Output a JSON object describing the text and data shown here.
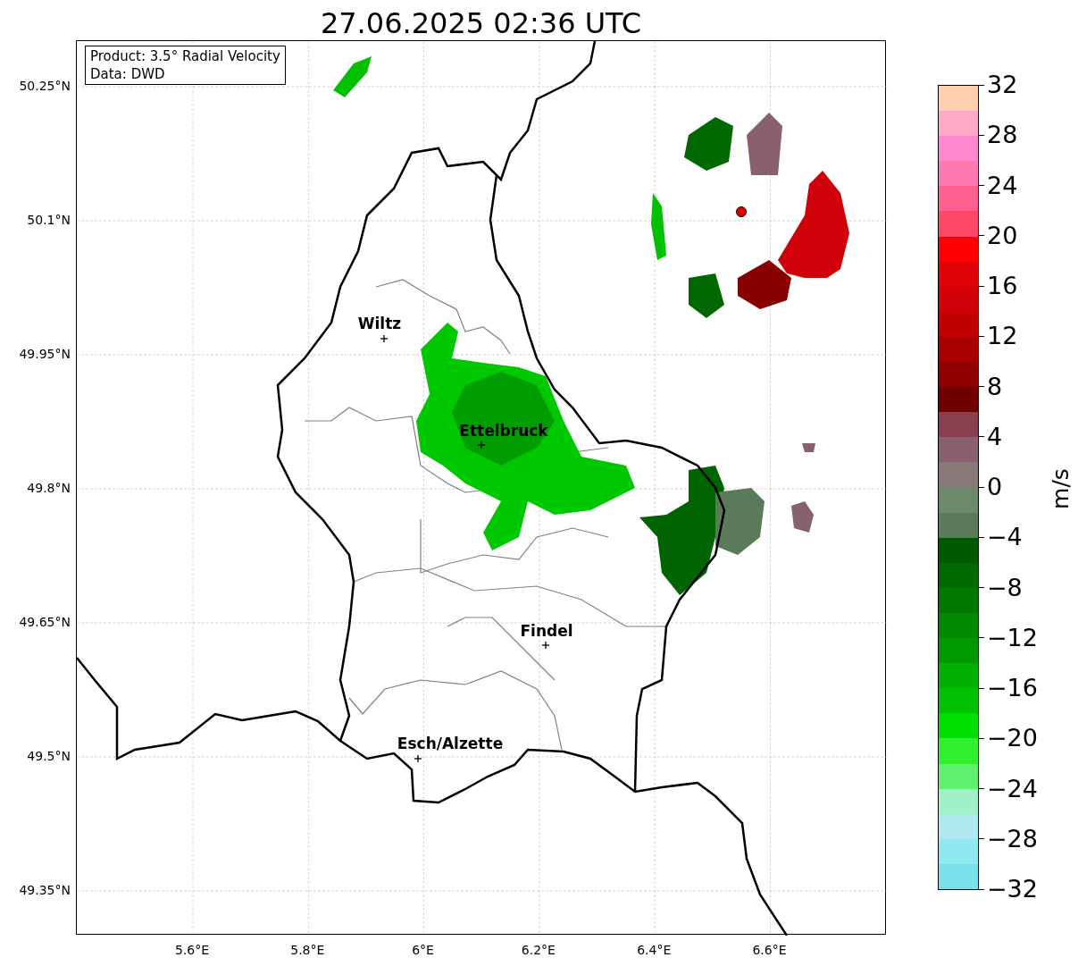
{
  "title": "27.06.2025 02:36 UTC",
  "info_box": [
    "Product: 3.5° Radial Velocity",
    "Data: DWD"
  ],
  "x_ticks": [
    "5.6°E",
    "5.8°E",
    "6°E",
    "6.2°E",
    "6.4°E",
    "6.6°E"
  ],
  "y_ticks": [
    "50.25°N",
    "50.1°N",
    "49.95°N",
    "49.8°N",
    "49.65°N",
    "49.5°N",
    "49.35°N"
  ],
  "cities": [
    {
      "name": "Wiltz"
    },
    {
      "name": "Ettelbruck"
    },
    {
      "name": "Findel"
    },
    {
      "name": "Esch/Alzette"
    }
  ],
  "colorbar": {
    "label": "m/s",
    "ticks": [
      "32",
      "28",
      "24",
      "20",
      "16",
      "12",
      "8",
      "4",
      "0",
      "−4",
      "−8",
      "−12",
      "−16",
      "−20",
      "−24",
      "−28",
      "−32"
    ],
    "bands": [
      {
        "color": "#ffcfb0"
      },
      {
        "color": "#ffa8c8"
      },
      {
        "color": "#ff88d0"
      },
      {
        "color": "#ff78b0"
      },
      {
        "color": "#ff6090"
      },
      {
        "color": "#ff4868"
      },
      {
        "color": "#ff0000"
      },
      {
        "color": "#e00008"
      },
      {
        "color": "#d00008"
      },
      {
        "color": "#c00000"
      },
      {
        "color": "#a80000"
      },
      {
        "color": "#900000"
      },
      {
        "color": "#700000"
      },
      {
        "color": "#884050"
      },
      {
        "color": "#886070"
      },
      {
        "color": "#887878"
      },
      {
        "color": "#6a8a6a"
      },
      {
        "color": "#5a7a5a"
      },
      {
        "color": "#005800"
      },
      {
        "color": "#006800"
      },
      {
        "color": "#007800"
      },
      {
        "color": "#008800"
      },
      {
        "color": "#009800"
      },
      {
        "color": "#00b000"
      },
      {
        "color": "#00c000"
      },
      {
        "color": "#00e000"
      },
      {
        "color": "#30f030"
      },
      {
        "color": "#60f070"
      },
      {
        "color": "#a0f0c8"
      },
      {
        "color": "#b0e8f0"
      },
      {
        "color": "#90e8f0"
      },
      {
        "color": "#78e0e8"
      }
    ]
  }
}
